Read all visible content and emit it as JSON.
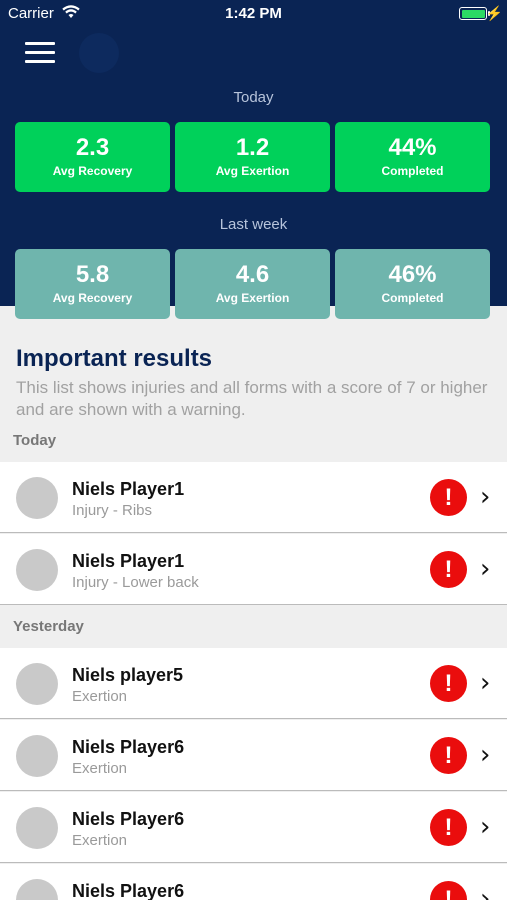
{
  "status_bar": {
    "carrier": "Carrier",
    "time": "1:42 PM"
  },
  "today_section": {
    "label": "Today",
    "stats": [
      {
        "value": "2.3",
        "label": "Avg Recovery"
      },
      {
        "value": "1.2",
        "label": "Avg Exertion"
      },
      {
        "value": "44%",
        "label": "Completed"
      }
    ]
  },
  "last_week_section": {
    "label": "Last week",
    "stats": [
      {
        "value": "5.8",
        "label": "Avg Recovery"
      },
      {
        "value": "4.6",
        "label": "Avg Exertion"
      },
      {
        "value": "46%",
        "label": "Completed"
      }
    ]
  },
  "important": {
    "title": "Important results",
    "description": "This list shows injuries and all forms with a score of 7 or higher and are shown with a warning."
  },
  "groups": [
    {
      "label": "Today",
      "rows": [
        {
          "name": "Niels Player1",
          "detail": "Injury - Ribs"
        },
        {
          "name": "Niels Player1",
          "detail": "Injury - Lower back"
        }
      ]
    },
    {
      "label": "Yesterday",
      "rows": [
        {
          "name": "Niels player5",
          "detail": "Exertion"
        },
        {
          "name": "Niels Player6",
          "detail": "Exertion"
        },
        {
          "name": "Niels Player6",
          "detail": "Exertion"
        },
        {
          "name": "Niels Player6",
          "detail": ""
        }
      ]
    }
  ],
  "warning_glyph": "!",
  "chevron_glyph": "›",
  "colors": {
    "header_bg": "#0a2454",
    "today_card": "#00d15a",
    "week_card": "#6fb5ad",
    "warning": "#ea0d0d"
  }
}
